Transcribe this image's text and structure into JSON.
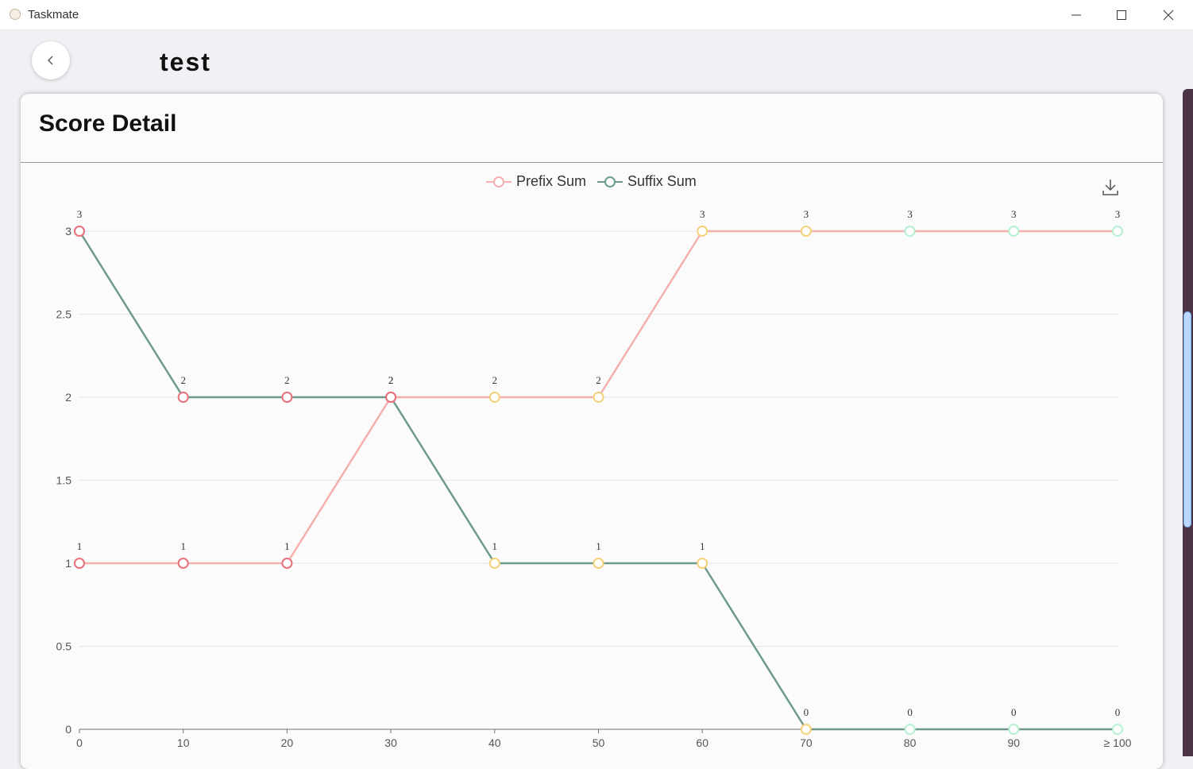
{
  "window": {
    "app_title": "Taskmate",
    "controls": [
      "minimize",
      "maximize",
      "close"
    ]
  },
  "header": {
    "back_icon": "chevron-left-icon",
    "page_title": "test"
  },
  "card": {
    "title": "Score Detail",
    "download_icon": "download-icon"
  },
  "colors": {
    "prefix_line": "#f4b0ae",
    "suffix_line": "#6e9a8b",
    "point_red": "#e8707a",
    "point_yellow": "#f5d27a",
    "point_mint": "#b6f0d2",
    "grid": "#e3e6ef",
    "axis": "#6e7079"
  },
  "chart_data": {
    "type": "line",
    "categories": [
      "0",
      "10",
      "20",
      "30",
      "40",
      "50",
      "60",
      "70",
      "80",
      "90",
      "≥ 100"
    ],
    "series": [
      {
        "name": "Prefix Sum",
        "values": [
          1,
          1,
          1,
          2,
          2,
          2,
          3,
          3,
          3,
          3,
          3
        ]
      },
      {
        "name": "Suffix Sum",
        "values": [
          3,
          2,
          2,
          2,
          1,
          1,
          1,
          0,
          0,
          0,
          0
        ]
      }
    ],
    "point_color_bands": [
      "red",
      "red",
      "red",
      "red",
      "yellow",
      "yellow",
      "yellow",
      "yellow",
      "mint",
      "mint",
      "mint"
    ],
    "ylim": [
      0,
      3
    ],
    "yticks": [
      "0",
      "0.5",
      "1",
      "1.5",
      "2",
      "2.5",
      "3"
    ],
    "legend": "top-center",
    "grid": true,
    "data_labels": true
  }
}
